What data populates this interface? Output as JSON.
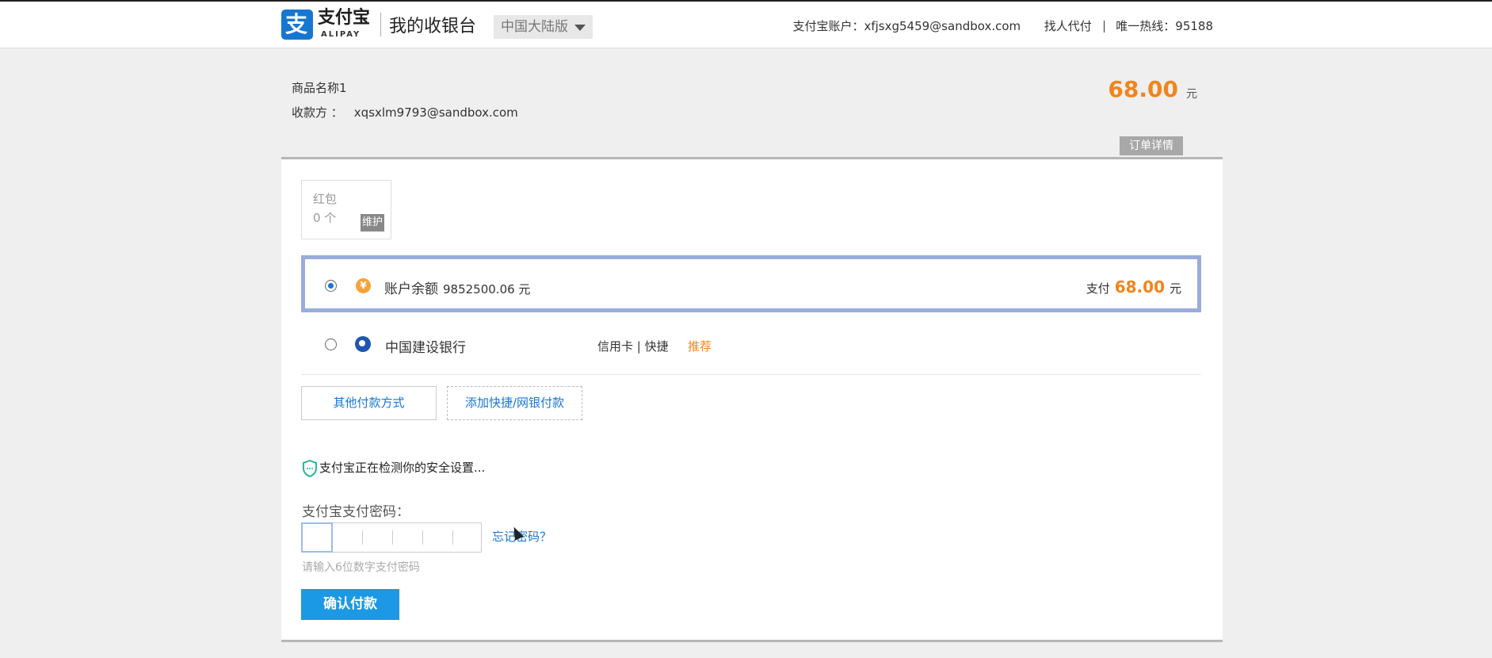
{
  "header": {
    "logo_cn": "支付宝",
    "logo_en": "ALIPAY",
    "logo_glyph": "支",
    "app_title": "我的收银台",
    "region": "中国大陆版",
    "account_label": "支付宝账户：",
    "account_email": "xfjsxg5459@sandbox.com",
    "find_payer": "找人代付",
    "hotline": "唯一热线：95188"
  },
  "order": {
    "product_name": "商品名称1",
    "payee_label": "收款方 ：",
    "payee_email": "xqsxlm9793@sandbox.com",
    "amount": "68.00",
    "currency": "元",
    "detail_button": "订单详情"
  },
  "red_packet": {
    "title": "红包",
    "count": "0 个",
    "maintenance": "维护"
  },
  "payment_options": {
    "balance": {
      "label": "账户余额",
      "value": "9852500.06 元",
      "coin_glyph": "¥",
      "pay_label": "支付",
      "pay_amount": "68.00",
      "pay_unit": "元",
      "selected": true
    },
    "bank": {
      "label": "中国建设银行",
      "types": "信用卡 | 快捷",
      "recommend": "推荐",
      "selected": false
    }
  },
  "actions": {
    "other_methods": "其他付款方式",
    "add_bank": "添加快捷/网银付款"
  },
  "security": {
    "checking_text": "支付宝正在检测你的安全设置..."
  },
  "password": {
    "label": "支付宝支付密码：",
    "forgot": "忘记密码？",
    "hint": "请输入6位数字支付密码"
  },
  "confirm_button": "确认付款",
  "colors": {
    "brand_blue": "#1677d2",
    "amount_orange": "#f2841a",
    "selected_border": "#9aacdc",
    "confirm_blue": "#1b99e5"
  }
}
